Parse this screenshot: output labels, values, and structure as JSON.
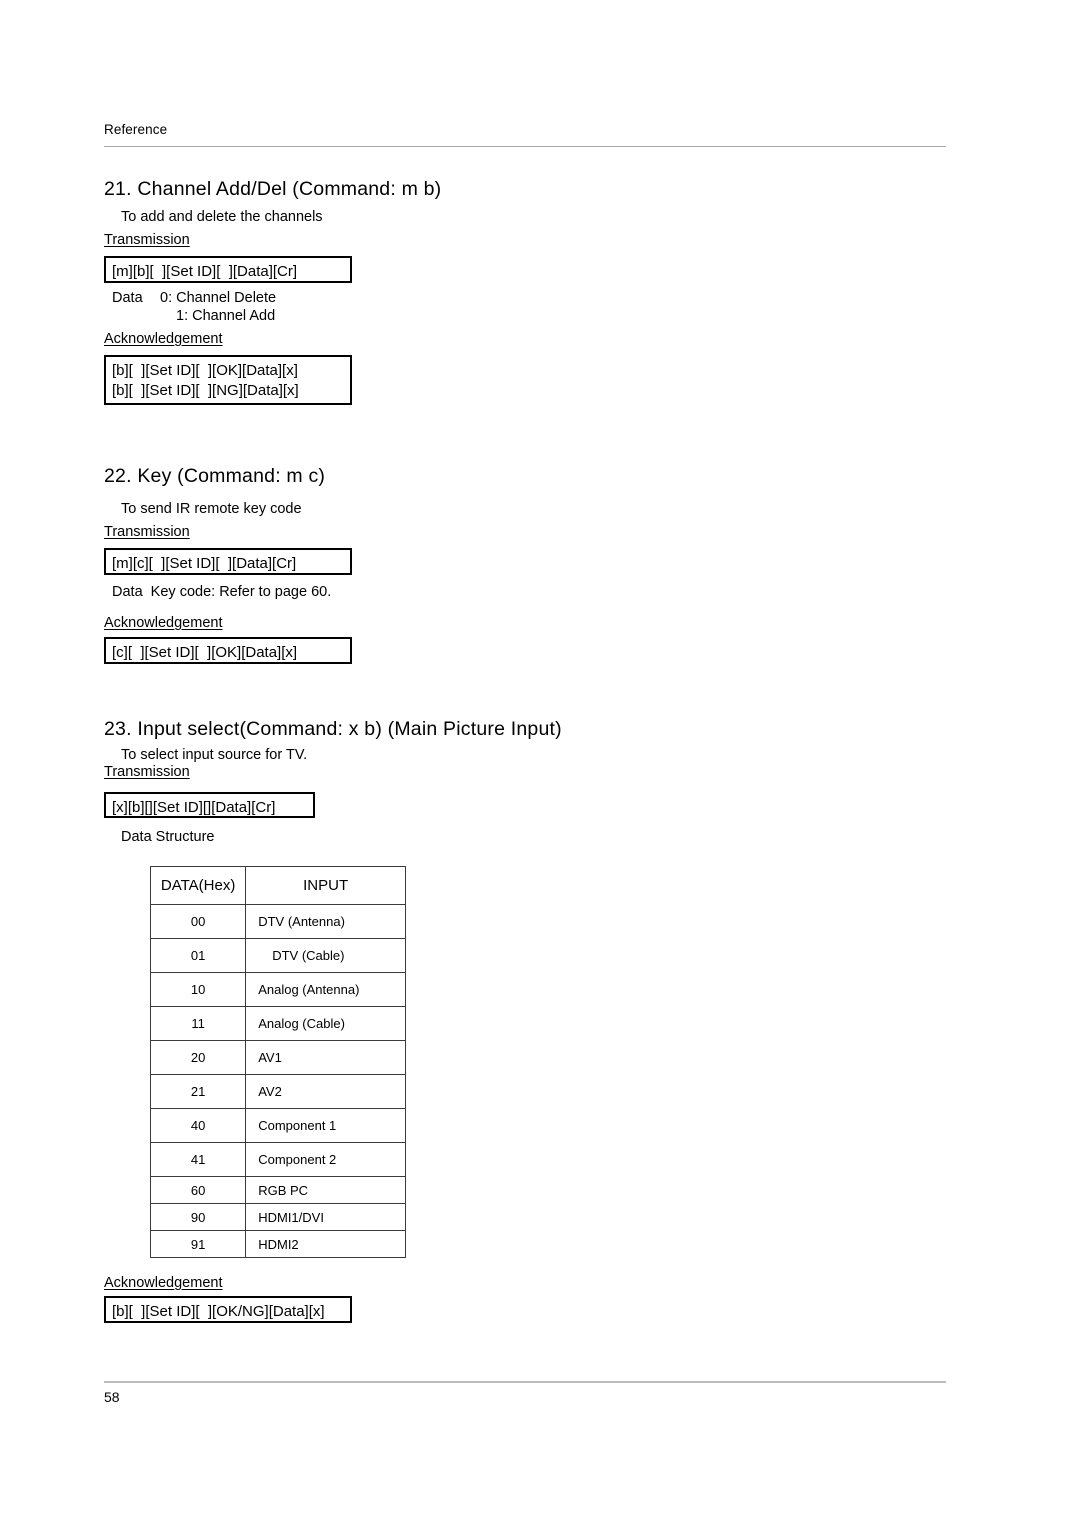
{
  "header": {
    "label": "Reference"
  },
  "footer": {
    "page_number": "58"
  },
  "sections": [
    {
      "title": "21. Channel Add/Del (Command: m b)",
      "description": "To add and delete the channels",
      "transmission_label": "Transmission",
      "transmission_box": "[m][b][  ][Set ID][  ][Data][Cr]",
      "data_label": "Data",
      "data_values": [
        "0: Channel Delete",
        "1: Channel Add"
      ],
      "acknowledgement_label": "Acknowledgement",
      "acknowledgement_lines": [
        "[b][  ][Set ID][  ][OK][Data][x]",
        "[b][  ][Set ID][  ][NG][Data][x]"
      ]
    },
    {
      "title": "22. Key (Command: m c)",
      "description": "To send IR remote key code",
      "transmission_label": "Transmission",
      "transmission_box": "[m][c][  ][Set ID][  ][Data][Cr]",
      "data_line": "Data  Key code: Refer to page 60.",
      "acknowledgement_label": "Acknowledgement",
      "acknowledgement_lines": [
        "[c][  ][Set ID][  ][OK][Data][x]"
      ]
    },
    {
      "title": "23. Input select(Command: x b) (Main Picture Input)",
      "description": "To select input source for TV.",
      "transmission_label": "Transmission",
      "transmission_box": "[x][b][][Set ID][][Data][Cr]",
      "data_structure_label": "Data Structure",
      "acknowledgement_label": "Acknowledgement",
      "acknowledgement_lines": [
        "[b][  ][Set ID][  ][OK/NG][Data][x]"
      ]
    }
  ],
  "data_structure_table": {
    "columns": [
      "DATA(Hex)",
      "INPUT"
    ],
    "rows": [
      {
        "hex": "00",
        "input": "DTV (Antenna)",
        "size": "tall",
        "indent": false
      },
      {
        "hex": "01",
        "input": "DTV (Cable)",
        "size": "tall",
        "indent": true
      },
      {
        "hex": "10",
        "input": "Analog (Antenna)",
        "size": "tall",
        "indent": false
      },
      {
        "hex": "11",
        "input": "Analog (Cable)",
        "size": "tall",
        "indent": false
      },
      {
        "hex": "20",
        "input": "AV1",
        "size": "tall",
        "indent": false
      },
      {
        "hex": "21",
        "input": "AV2",
        "size": "tall",
        "indent": false
      },
      {
        "hex": "40",
        "input": "Component 1",
        "size": "tall",
        "indent": false
      },
      {
        "hex": "41",
        "input": "Component 2",
        "size": "tall",
        "indent": false
      },
      {
        "hex": "60",
        "input": "RGB PC",
        "size": "short",
        "indent": false
      },
      {
        "hex": "90",
        "input": "HDMI1/DVI",
        "size": "short",
        "indent": false
      },
      {
        "hex": "91",
        "input": "HDMI2",
        "size": "short",
        "indent": false
      }
    ]
  }
}
